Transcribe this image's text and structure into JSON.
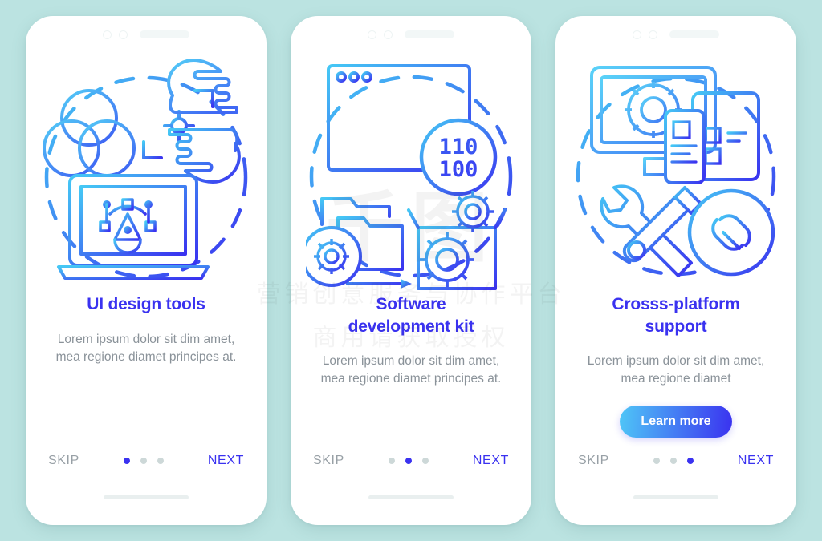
{
  "background_color": "#bbe3e1",
  "theme": {
    "accent": "#3a32f0",
    "accent_light": "#4fc6f7",
    "muted_text": "#8a9299",
    "dot_inactive": "#cdd8d8"
  },
  "watermark": {
    "logo": "千图",
    "line1": "营销创意服务与协作平台",
    "line2": "商用请获取授权"
  },
  "screens": [
    {
      "id": "ui-design-tools",
      "illustration": "ui-design-tools-illustration",
      "icons": [
        "venn-circles-icon",
        "pointing-hand-icon",
        "crop-frame-icon",
        "target-crosshair-icon",
        "laptop-icon",
        "pen-tool-icon"
      ],
      "title": "UI design tools",
      "description": "Lorem ipsum dolor sit dim amet, mea regione diamet principes at.",
      "cta": null,
      "skip_label": "SKIP",
      "next_label": "NEXT",
      "dots": 3,
      "active_dot": 0
    },
    {
      "id": "software-development-kit",
      "illustration": "software-development-kit-illustration",
      "icons": [
        "code-window-icon",
        "binary-badge-icon",
        "folder-icon",
        "gear-icon",
        "open-box-icon",
        "arrow-icon"
      ],
      "binary_top": "110",
      "binary_bottom": "100",
      "title": "Software development kit",
      "description": "Lorem ipsum dolor sit dim amet, mea regione diamet principes at.",
      "cta": null,
      "skip_label": "SKIP",
      "next_label": "NEXT",
      "dots": 3,
      "active_dot": 1
    },
    {
      "id": "cross-platform-support",
      "illustration": "cross-platform-support-illustration",
      "icons": [
        "monitor-icon",
        "gear-icon",
        "tablet-icon",
        "smartphone-icon",
        "wrench-icon",
        "screwdriver-icon",
        "link-icon"
      ],
      "title": "Crosss-platform support",
      "description": "Lorem ipsum dolor sit dim amet, mea regione diamet",
      "cta": "Learn more",
      "skip_label": "SKIP",
      "next_label": "NEXT",
      "dots": 3,
      "active_dot": 2
    }
  ]
}
